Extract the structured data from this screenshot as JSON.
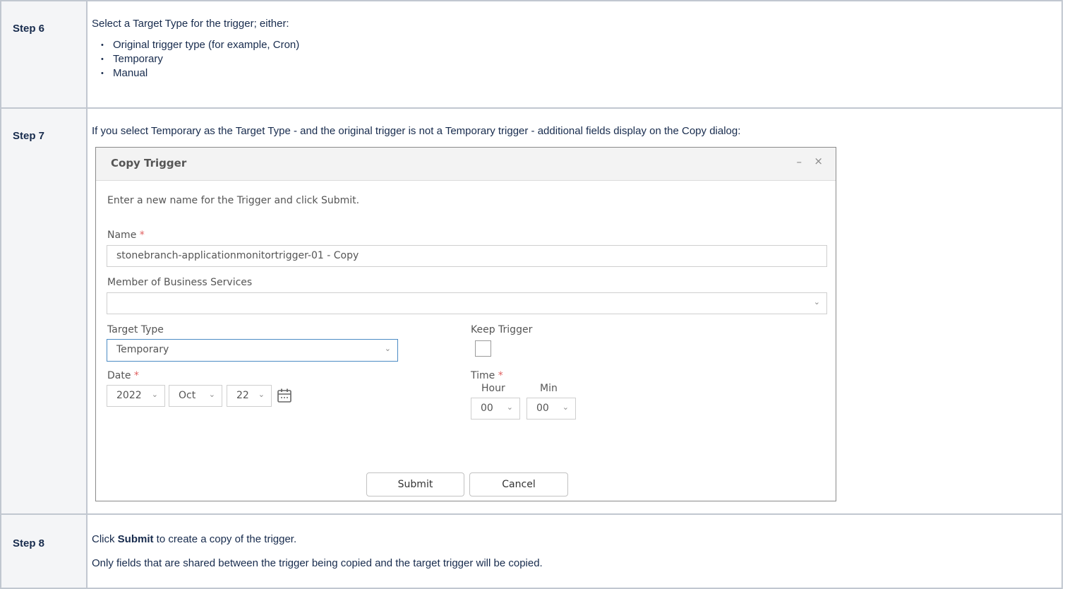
{
  "steps": [
    {
      "label": "Step 6",
      "text": "Select a Target Type for the trigger; either:",
      "bullets": [
        "Original trigger type (for example, Cron)",
        "Temporary",
        "Manual"
      ]
    },
    {
      "label": "Step 7",
      "text": "If you select Temporary as the Target Type - and the original trigger is not a Temporary trigger - additional fields display on the Copy dialog:"
    },
    {
      "label": "Step 8",
      "text_before_bold": "Click ",
      "bold": "Submit",
      "text_after_bold": " to create a copy of the trigger.",
      "text2": "Only fields that are shared between the trigger being copied and the target trigger will be copied."
    }
  ],
  "dialog": {
    "title": "Copy Trigger",
    "minimize_glyph": "–",
    "close_glyph": "×",
    "instruction": "Enter a new name for the Trigger and click Submit.",
    "name_label": "Name",
    "required_mark": "*",
    "name_value": "stonebranch-applicationmonitortrigger-01 - Copy",
    "member_label": "Member of Business Services",
    "member_value": "",
    "target_type_label": "Target Type",
    "target_type_value": "Temporary",
    "keep_trigger_label": "Keep Trigger",
    "keep_trigger_checked": false,
    "date_label": "Date",
    "date_year": "2022",
    "date_month": "Oct",
    "date_day": "22",
    "time_label": "Time",
    "hour_label": "Hour",
    "min_label": "Min",
    "hour_value": "00",
    "min_value": "00",
    "submit_label": "Submit",
    "cancel_label": "Cancel"
  }
}
